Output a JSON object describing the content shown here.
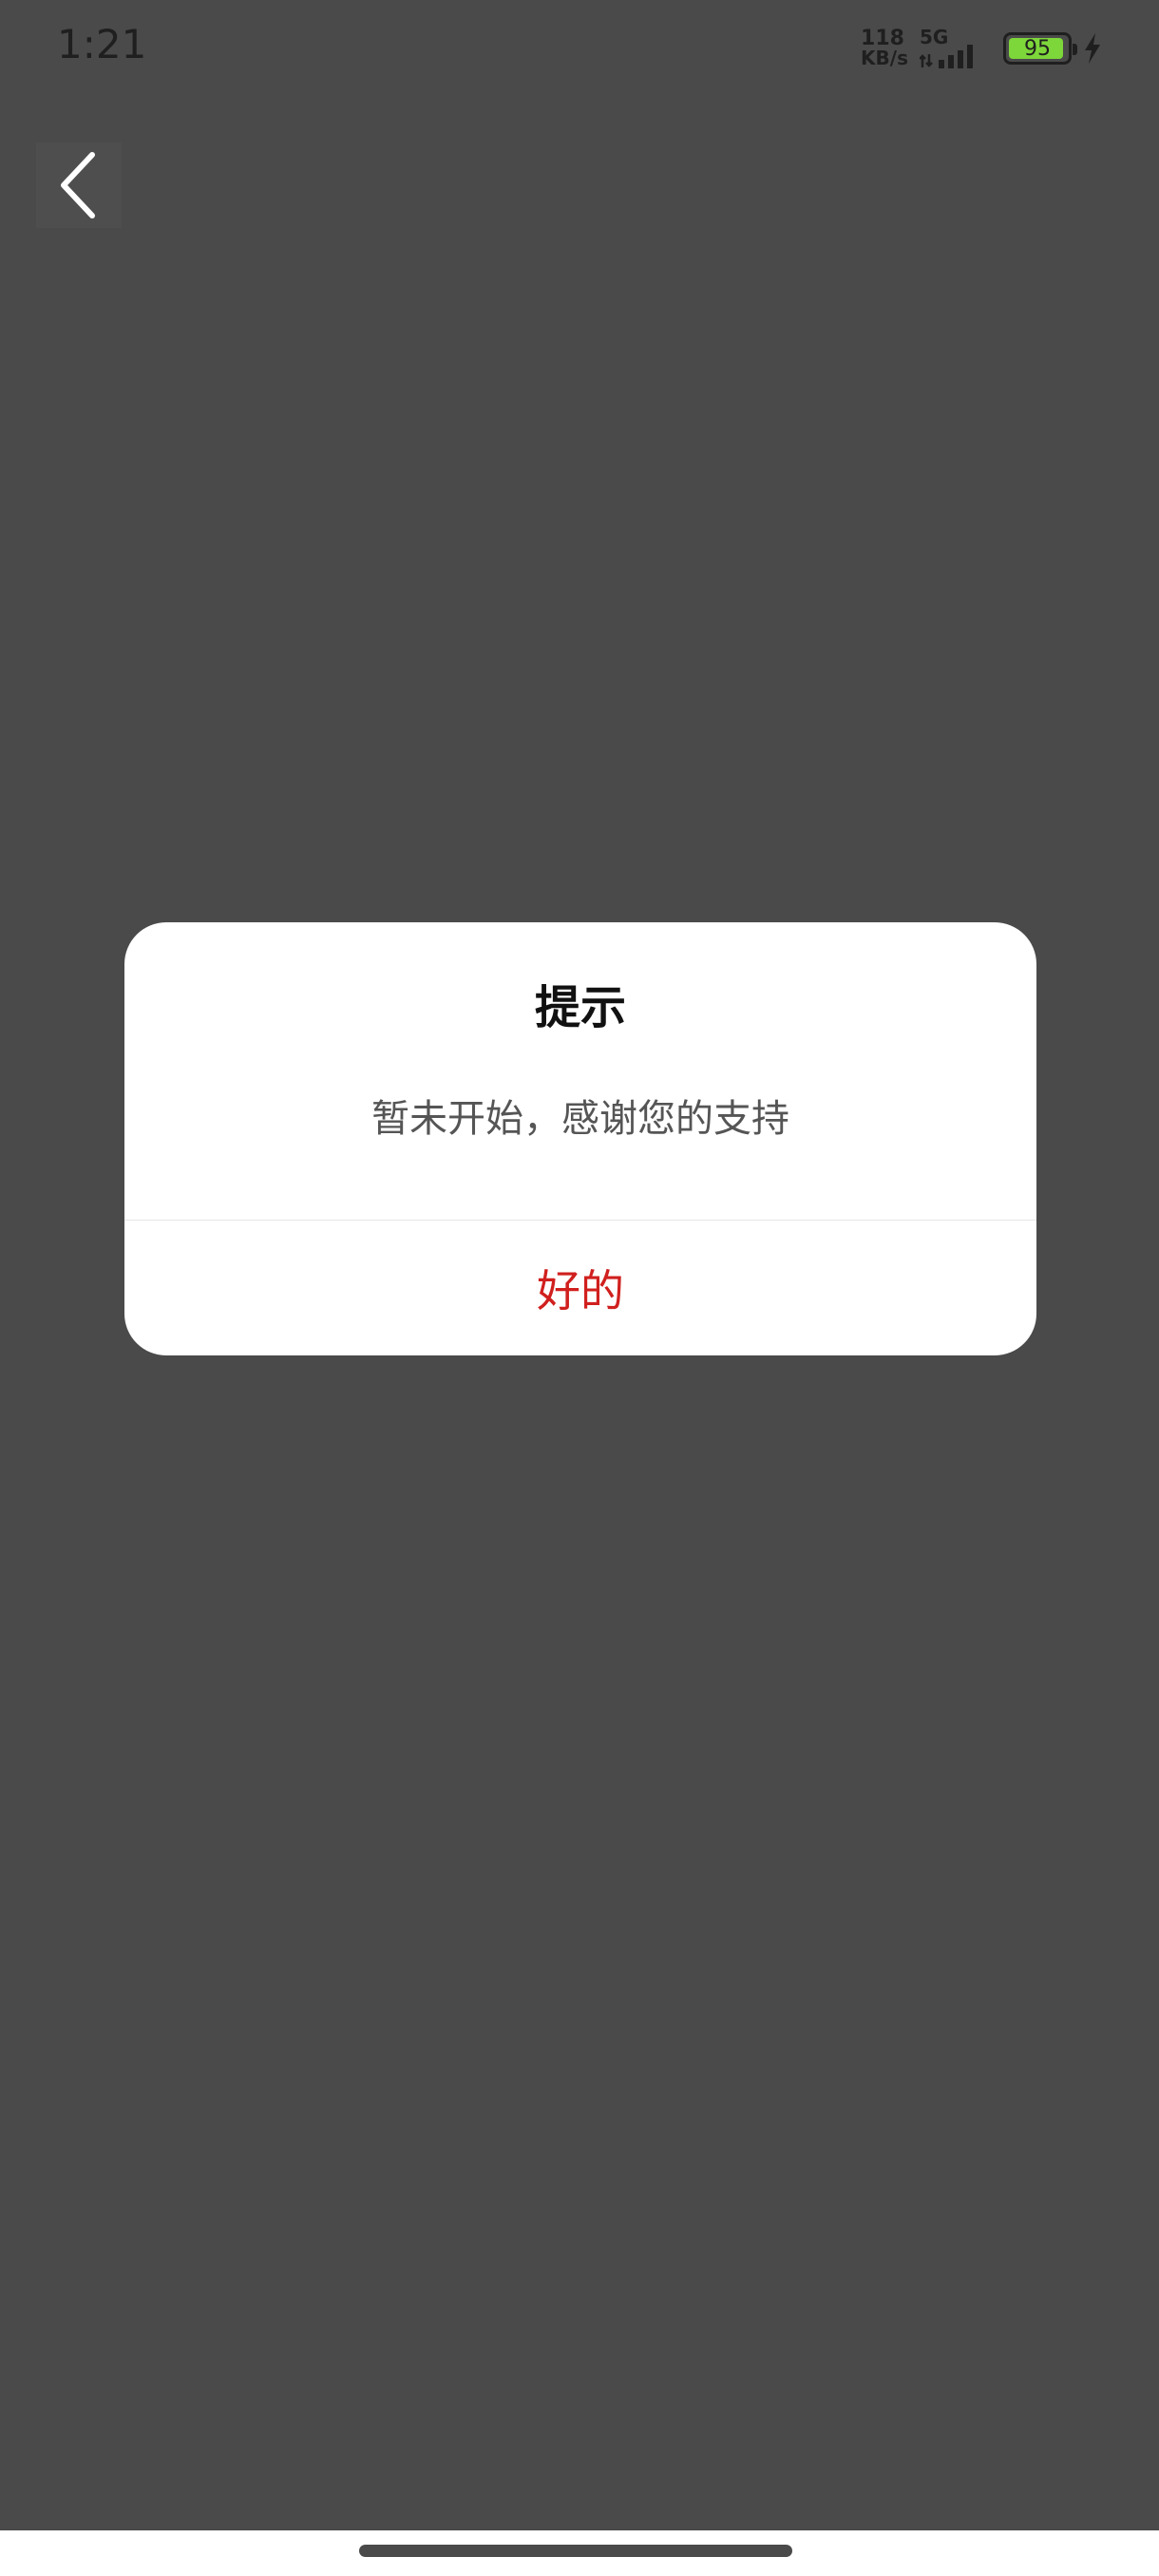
{
  "status_bar": {
    "time": "1:21",
    "net_speed_value": "118",
    "net_speed_unit": "KB/s",
    "network_type": "5G",
    "battery_level": "95",
    "battery_fraction": 0.95,
    "charging": true,
    "battery_color": "#7dd63a"
  },
  "nav": {
    "back_icon": "chevron-left-icon"
  },
  "dialog": {
    "title": "提示",
    "message": "暂未开始，感谢您的支持",
    "confirm_label": "好的",
    "confirm_color": "#d0201e"
  },
  "colors": {
    "overlay_background": "#4a4a4a",
    "dialog_background": "#ffffff"
  }
}
